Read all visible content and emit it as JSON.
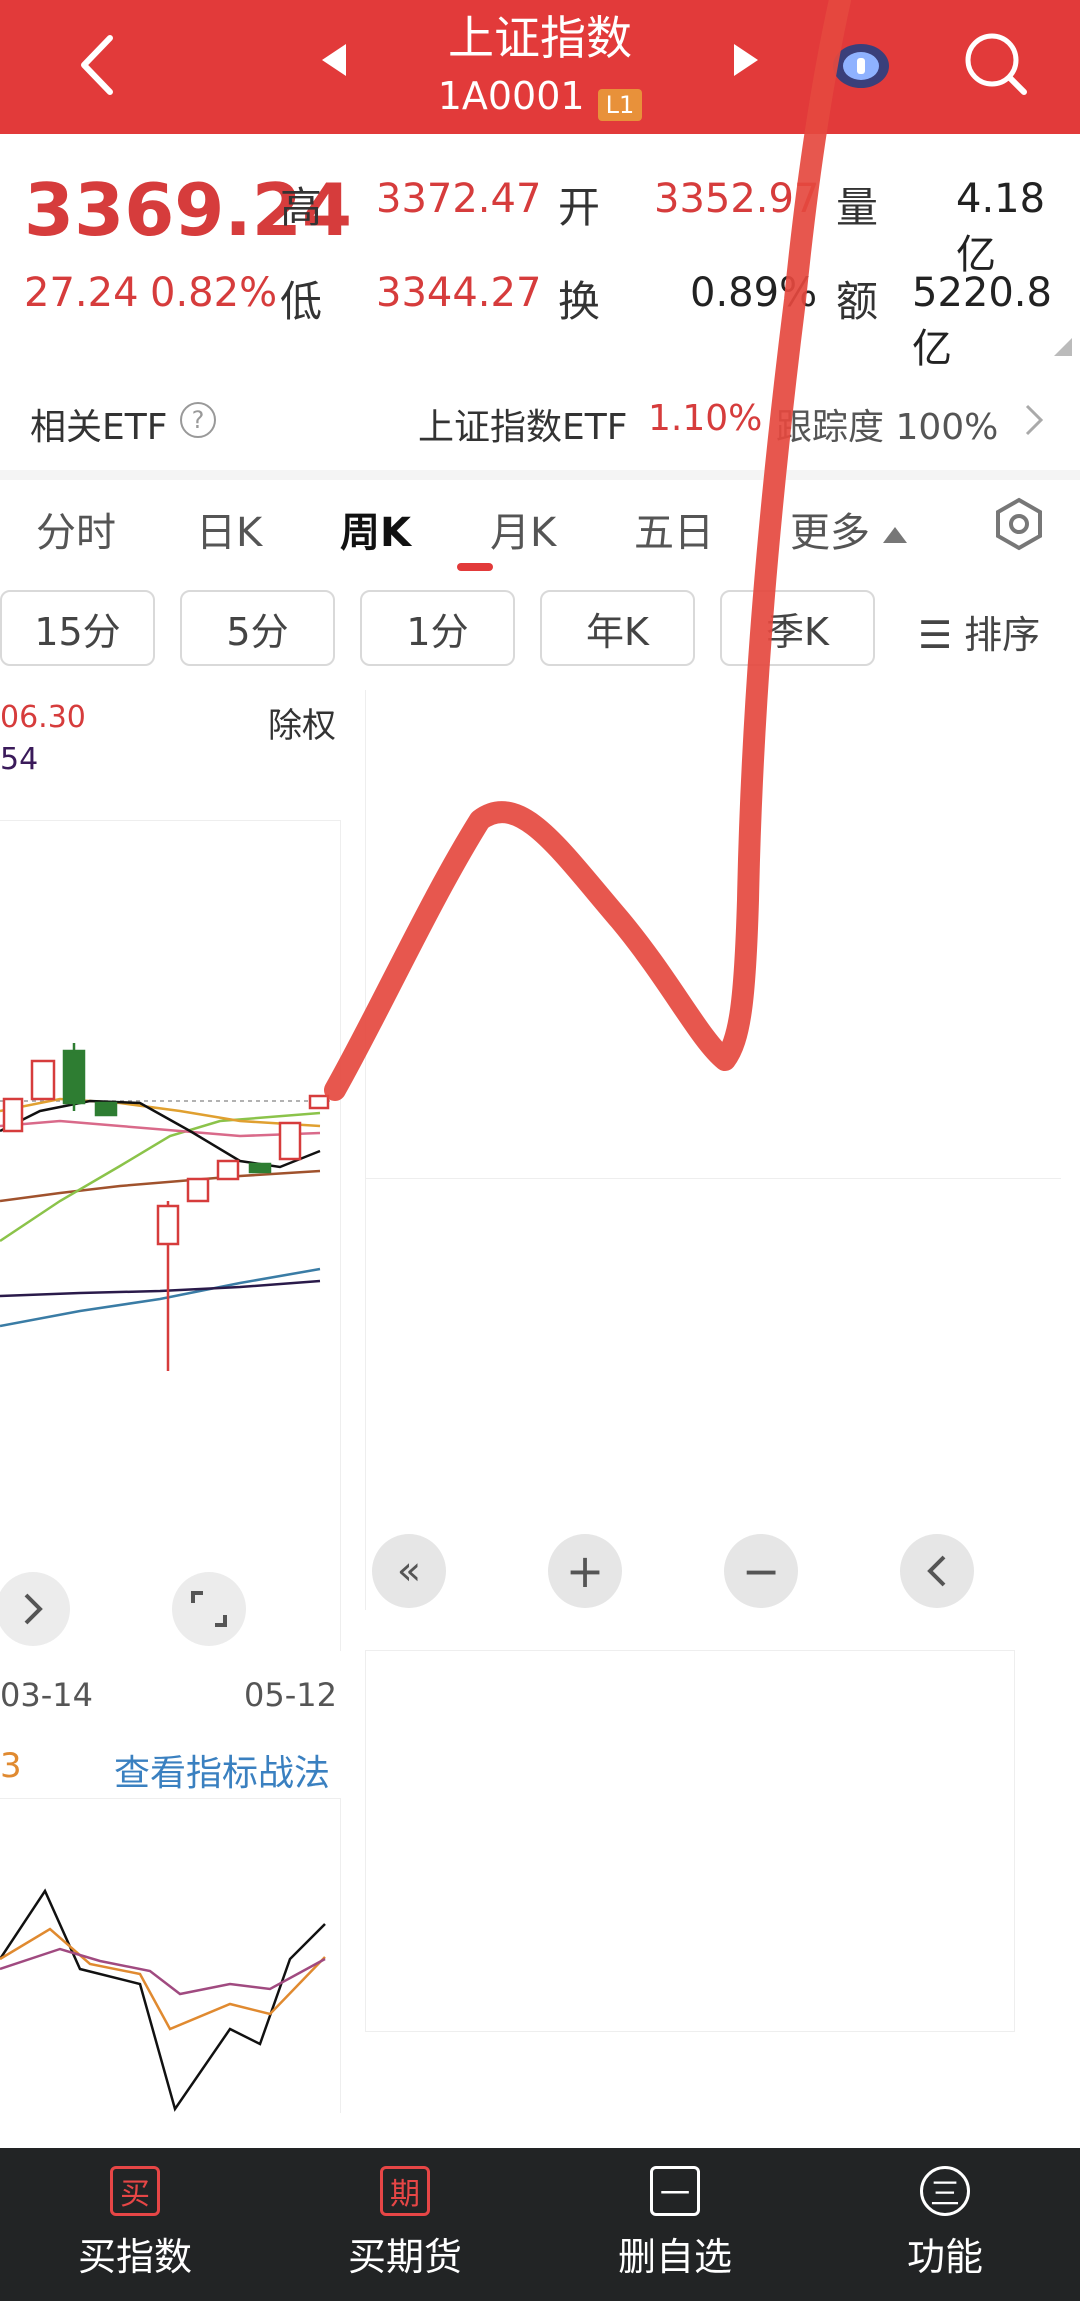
{
  "header": {
    "title": "上证指数",
    "code": "1A0001",
    "level_badge": "L1"
  },
  "quote": {
    "price": "3369.24",
    "change": "27.24",
    "change_pct": "0.82%",
    "high_label": "高",
    "high": "3372.47",
    "low_label": "低",
    "low": "3344.27",
    "open_label": "开",
    "open": "3352.97",
    "turnover_label": "换",
    "turnover": "0.89%",
    "volume_label": "量",
    "volume": "4.18亿",
    "amount_label": "额",
    "amount": "5220.8亿"
  },
  "etf": {
    "label": "相关ETF",
    "name": "上证指数ETF",
    "pct": "1.10%",
    "tracking": "跟踪度 100%"
  },
  "tabs": [
    "分时",
    "日K",
    "周K",
    "月K",
    "五日",
    "更多"
  ],
  "active_tab": "周K",
  "periods": [
    "15分",
    "5分",
    "1分",
    "年K",
    "季K"
  ],
  "sort_label": "排序",
  "chart": {
    "ma_value": "06.30",
    "ma_value2": "54",
    "adjust_label": "除权",
    "date_start": "03-14",
    "date_end": "05-12",
    "indicator_value": "3",
    "indicator_link": "查看指标战法"
  },
  "chart_data": {
    "type": "candlestick",
    "x": [
      "03-14",
      "",
      "",
      "",
      "",
      "",
      "",
      "",
      "",
      "",
      "",
      "05-12"
    ],
    "candles": [
      {
        "dir": "up"
      },
      {
        "dir": "up"
      },
      {
        "dir": "down"
      },
      {
        "dir": "down"
      },
      {
        "dir": "up"
      },
      {
        "dir": "up"
      },
      {
        "dir": "up"
      },
      {
        "dir": "down"
      },
      {
        "dir": "up"
      },
      {
        "dir": "up"
      }
    ]
  },
  "colors": {
    "brand_red": "#e23a3a",
    "up_red": "#d63c3c",
    "down_green": "#2e7d32",
    "bottom_bar": "#222425"
  },
  "bottom_nav": [
    {
      "icon": "买",
      "label": "买指数"
    },
    {
      "icon": "期",
      "label": "买期货"
    },
    {
      "icon": "一",
      "label": "删自选"
    },
    {
      "icon": "三",
      "label": "功能"
    }
  ]
}
